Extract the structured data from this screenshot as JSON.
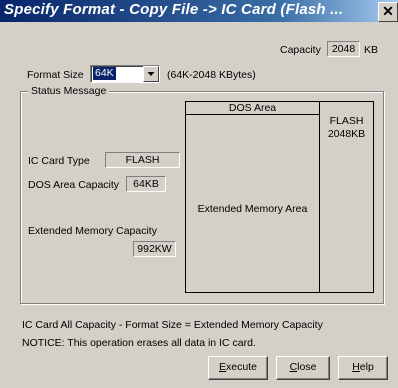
{
  "window": {
    "title": "Specify Format - Copy File -> IC Card (Flash ...",
    "close_glyph": "✕"
  },
  "capacity": {
    "label": "Capacity",
    "value": "2048",
    "unit": "KB"
  },
  "format_size": {
    "label": "Format Size",
    "selected": "64K",
    "range_note": "(64K-2048 KBytes)"
  },
  "status": {
    "group_label": "Status Message",
    "ic_card_type_label": "IC Card Type",
    "ic_card_type_value": "FLASH",
    "dos_area_capacity_label": "DOS Area Capacity",
    "dos_area_capacity_value": "64KB",
    "extended_memory_capacity_label": "Extended Memory Capacity",
    "extended_memory_capacity_value": "992KW"
  },
  "diagram": {
    "dos_area_label": "DOS Area",
    "extended_area_label": "Extended Memory Area",
    "flash_label": "FLASH",
    "flash_size": "2048KB"
  },
  "formula_text": "IC Card All Capacity - Format Size = Extended Memory Capacity",
  "notice_text": "NOTICE: This operation erases all data in IC card.",
  "buttons": {
    "execute": {
      "first": "E",
      "rest": "xecute"
    },
    "close": {
      "first": "C",
      "rest": "lose"
    },
    "help": {
      "first": "H",
      "rest": "elp"
    }
  }
}
